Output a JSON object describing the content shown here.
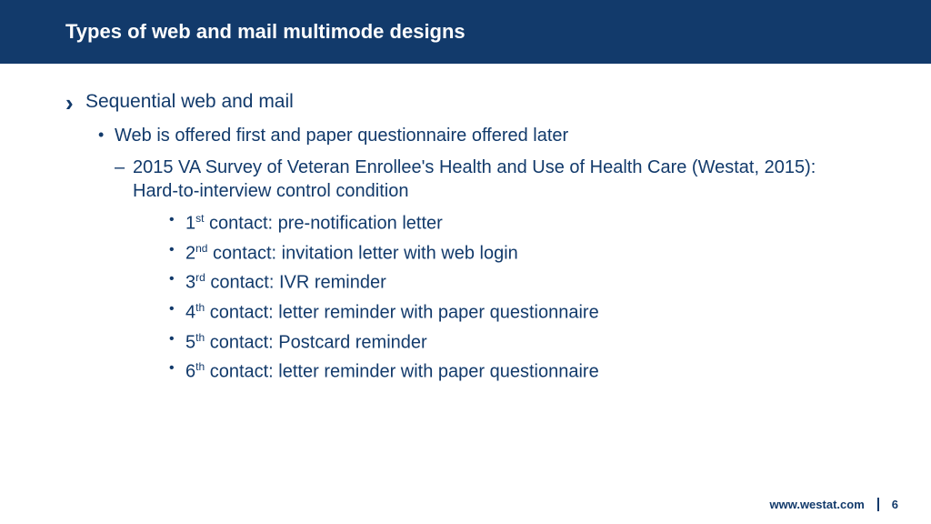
{
  "title": "Types of web and mail multimode designs",
  "b1": "Sequential web and mail",
  "b2": "Web is offered first and paper questionnaire offered later",
  "b3": "2015 VA Survey of Veteran Enrollee's Health and Use of Health Care (Westat, 2015): Hard-to-interview control condition",
  "contacts": [
    {
      "ord": "1",
      "suffix": "st",
      "text": " contact: pre-notification letter"
    },
    {
      "ord": "2",
      "suffix": "nd",
      "text": " contact: invitation letter with web login"
    },
    {
      "ord": "3",
      "suffix": "rd",
      "text": " contact: IVR reminder"
    },
    {
      "ord": "4",
      "suffix": "th",
      "text": " contact: letter reminder with paper questionnaire"
    },
    {
      "ord": "5",
      "suffix": "th",
      "text": " contact: Postcard reminder"
    },
    {
      "ord": "6",
      "suffix": "th",
      "text": " contact: letter reminder with paper questionnaire"
    }
  ],
  "url": "www.westat.com",
  "page": "6"
}
